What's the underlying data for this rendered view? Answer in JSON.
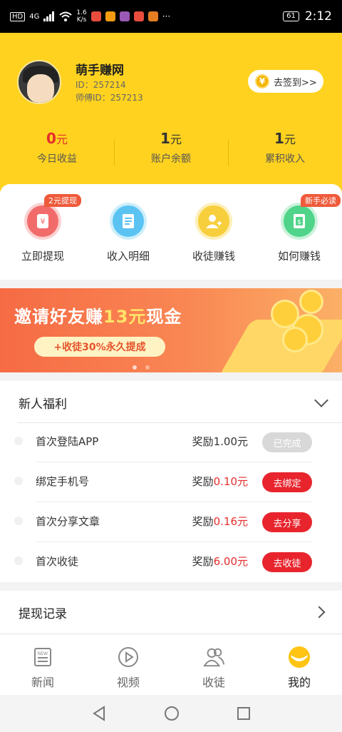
{
  "status_bar": {
    "left_labels": [
      "HD",
      "4G"
    ],
    "net_speed_value": "1.6",
    "net_speed_unit": "K/s",
    "more": "···",
    "battery": "61",
    "time": "2:12"
  },
  "profile": {
    "name": "萌手赚网",
    "id_text": "ID：257214",
    "master_id_text": "师傅ID：257213",
    "signin_icon": "¥",
    "signin_label": "去签到>>"
  },
  "stats": [
    {
      "value": "0",
      "unit": "元",
      "label": "今日收益",
      "highlight": true
    },
    {
      "value": "1",
      "unit": "元",
      "label": "账户余额",
      "highlight": false
    },
    {
      "value": "1",
      "unit": "元",
      "label": "累积收入",
      "highlight": false
    }
  ],
  "quick_actions": [
    {
      "label": "立即提现",
      "badge": "2元提现",
      "icon": "yen-icon",
      "color": "#f26b6b"
    },
    {
      "label": "收入明细",
      "badge": "",
      "icon": "document-icon",
      "color": "#5bc3f2"
    },
    {
      "label": "收徒赚钱",
      "badge": "",
      "icon": "add-user-icon",
      "color": "#f7cf3d"
    },
    {
      "label": "如何赚钱",
      "badge": "新手必读",
      "icon": "money-note-icon",
      "color": "#4fd48a"
    }
  ],
  "banner": {
    "title_pre": "邀请好友赚",
    "title_amount": "13元",
    "title_post": "现金",
    "subtitle": "+收徒30%永久提成"
  },
  "welfare": {
    "title": "新人福利",
    "tasks": [
      {
        "name": "首次登陆APP",
        "reward_prefix": "奖励",
        "amount": "1.00元",
        "button": "已完成",
        "done": true
      },
      {
        "name": "绑定手机号",
        "reward_prefix": "奖励",
        "amount": "0.10元",
        "button": "去绑定",
        "done": false
      },
      {
        "name": "首次分享文章",
        "reward_prefix": "奖励",
        "amount": "0.16元",
        "button": "去分享",
        "done": false
      },
      {
        "name": "首次收徒",
        "reward_prefix": "奖励",
        "amount": "6.00元",
        "button": "去收徒",
        "done": false
      }
    ]
  },
  "records": {
    "label": "提现记录"
  },
  "tabs": [
    {
      "label": "新闻",
      "icon": "news-icon",
      "active": false
    },
    {
      "label": "视频",
      "icon": "play-icon",
      "active": false
    },
    {
      "label": "收徒",
      "icon": "users-icon",
      "active": false
    },
    {
      "label": "我的",
      "icon": "smile-icon",
      "active": true
    }
  ],
  "colors": {
    "header_yellow": "#ffd21f",
    "accent_red": "#e8242d",
    "banner_orange": "#f66b44"
  }
}
